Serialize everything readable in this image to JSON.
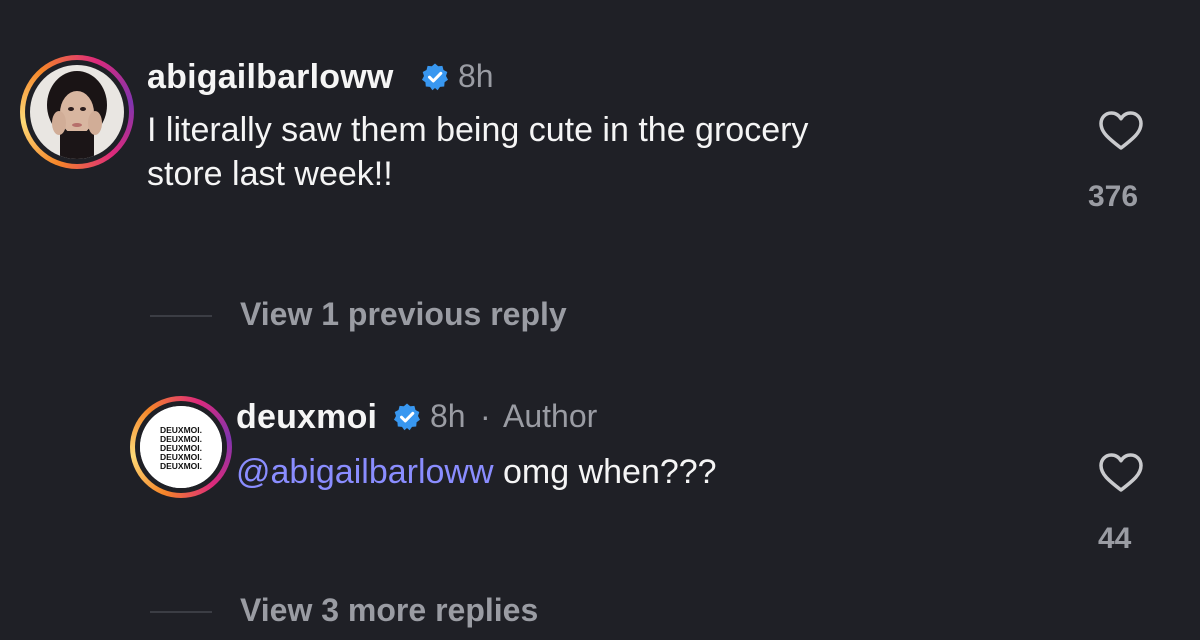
{
  "comments": [
    {
      "username": "abigailbarloww",
      "time": "8h",
      "text": "I literally saw them being cute in the grocery",
      "text_line2": "store last week!!",
      "likes": "376"
    },
    {
      "username": "deuxmoi",
      "time": "8h",
      "separator": "·",
      "author_label": "Author",
      "mention": "@abigailbarloww",
      "text": "omg when???",
      "likes": "44",
      "avatar_text": "DEUXMOI."
    }
  ],
  "replies": {
    "view_previous": "View 1 previous reply",
    "view_more": "View 3 more replies"
  },
  "icons": {
    "verified": "verified-badge-icon",
    "like": "heart-outline-icon"
  },
  "colors": {
    "background": "#1f2026",
    "verified_blue": "#3897f0",
    "mention": "#8a8dff",
    "muted": "#9a9ca3"
  }
}
